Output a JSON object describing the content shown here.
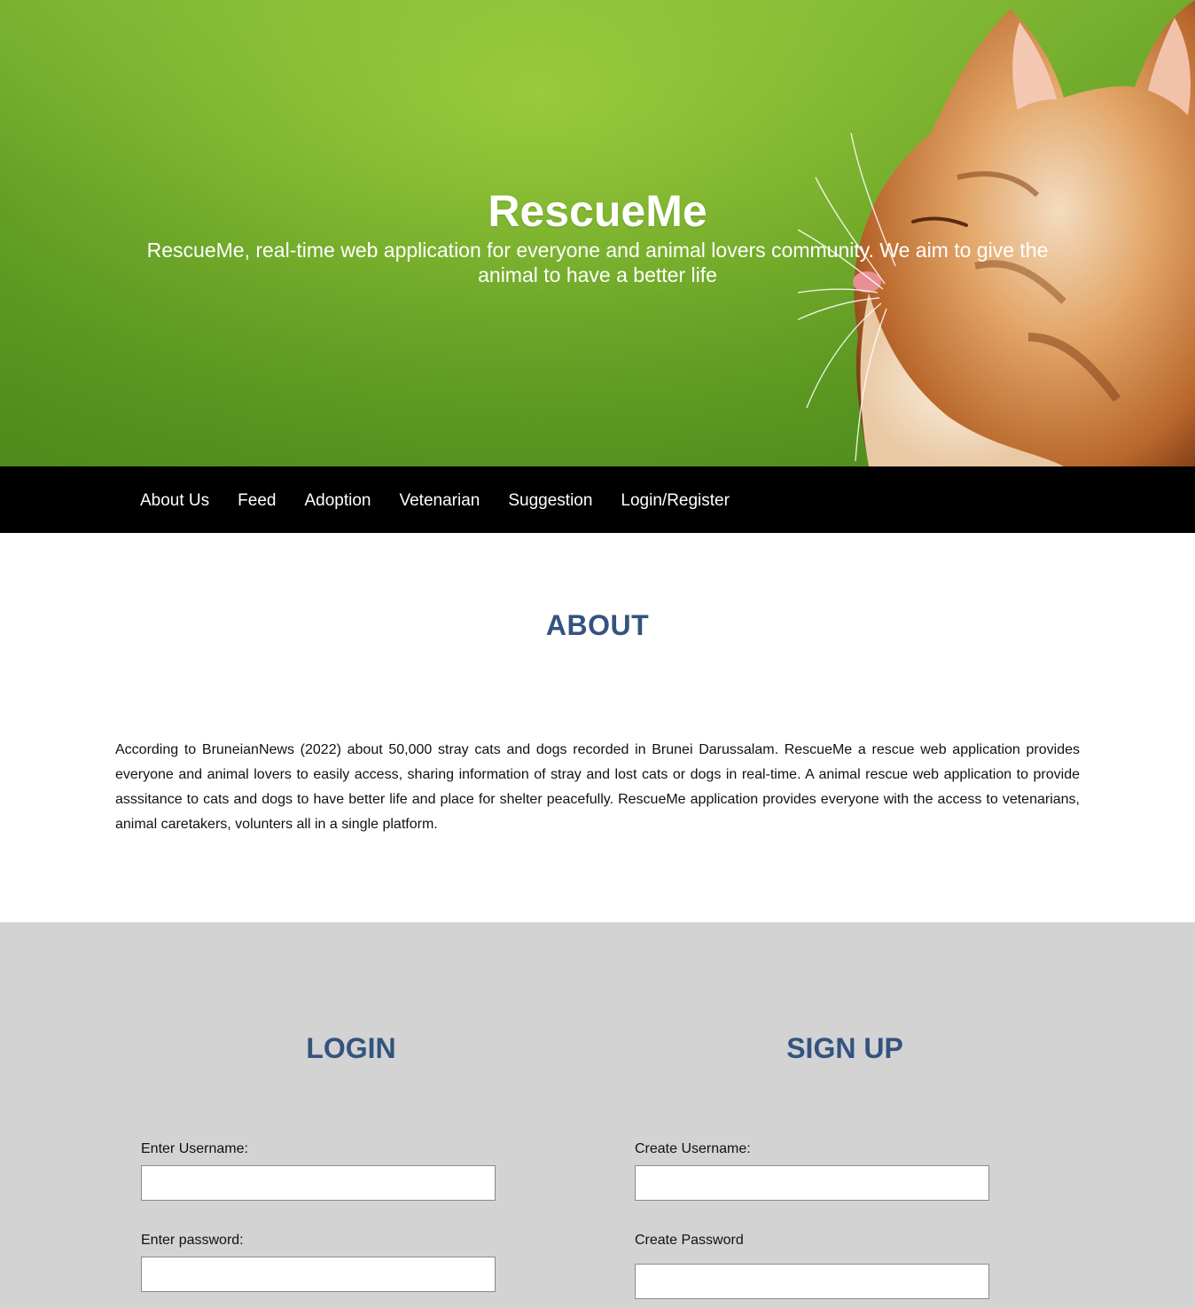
{
  "hero": {
    "title": "RescueMe",
    "subtitle": "RescueMe, real-time web application for everyone and animal lovers community. We aim to give the animal to have a better life"
  },
  "nav": {
    "items": [
      "About Us",
      "Feed",
      "Adoption",
      "Vetenarian",
      "Suggestion",
      "Login/Register"
    ]
  },
  "about": {
    "heading": "ABOUT",
    "text": "According to BruneianNews (2022) about 50,000 stray cats and dogs recorded in Brunei Darussalam. RescueMe a rescue web application provides everyone and animal lovers to easily access, sharing information of stray and lost cats or dogs in real-time. A animal rescue web application to provide asssitance to cats and dogs to have better life and place for shelter peacefully. RescueMe application provides everyone with the access to vetenarians, animal caretakers, volunters all in a single platform."
  },
  "login": {
    "heading": "LOGIN",
    "username_label": "Enter Username:",
    "password_label": "Enter password:",
    "username_value": "",
    "password_value": ""
  },
  "signup": {
    "heading": "SIGN UP",
    "username_label": "Create Username:",
    "password_label": "Create Password",
    "username_value": "",
    "password_value": ""
  },
  "colors": {
    "nav_background": "#000000",
    "heading": "#34537e",
    "auth_background": "#d3d3d3"
  }
}
